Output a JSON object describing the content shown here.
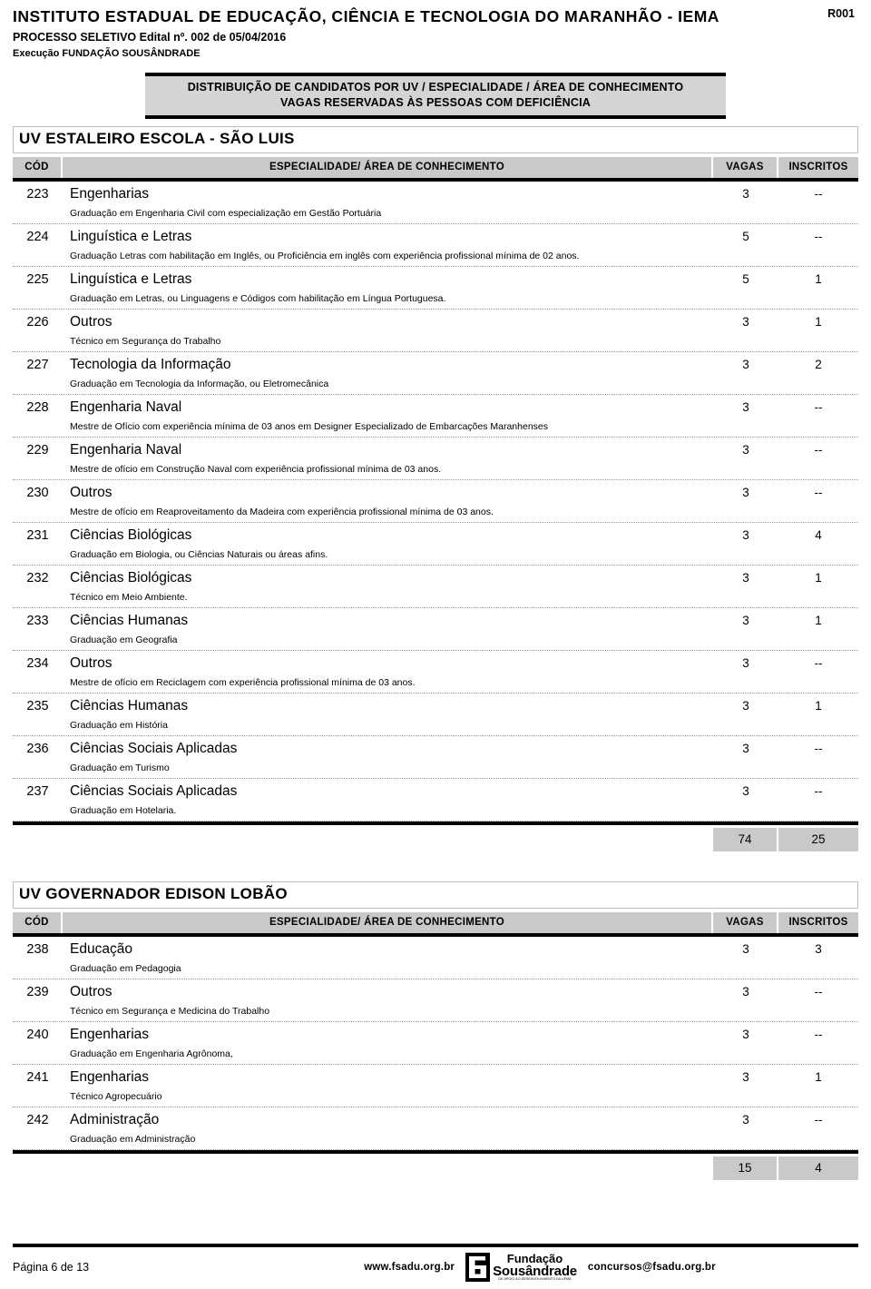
{
  "header": {
    "institution": "INSTITUTO ESTADUAL DE EDUCAÇÃO, CIÊNCIA E TECNOLOGIA DO MARANHÃO - IEMA",
    "doc_code": "R001",
    "process_line": "PROCESSO SELETIVO Edital nº. 002 de 05/04/2016",
    "execution_line": "Execução FUNDAÇÃO SOUSÂNDRADE"
  },
  "banner": {
    "line1": "DISTRIBUIÇÃO DE CANDIDATOS POR UV / ESPECIALIDADE / ÁREA DE CONHECIMENTO",
    "line2": "VAGAS RESERVADAS ÀS PESSOAS COM DEFICIÊNCIA"
  },
  "columns": {
    "cod": "CÓD",
    "especialidade": "ESPECIALIDADE/ ÁREA DE CONHECIMENTO",
    "vagas": "VAGAS",
    "inscritos": "INSCRITOS"
  },
  "sections": [
    {
      "title": "UV ESTALEIRO ESCOLA - SÃO LUIS",
      "rows": [
        {
          "cod": "223",
          "especialidade": "Engenharias",
          "descricao": "Graduação em Engenharia Civil com especialização em Gestão Portuária",
          "vagas": "3",
          "inscritos": "--"
        },
        {
          "cod": "224",
          "especialidade": "Linguística e Letras",
          "descricao": "Graduação Letras com habilitação em Inglês, ou Proficiência em inglês com experiência profissional mínima de 02 anos.",
          "vagas": "5",
          "inscritos": "--"
        },
        {
          "cod": "225",
          "especialidade": "Linguística e Letras",
          "descricao": "Graduação em Letras, ou Linguagens e Códigos com habilitação em Língua Portuguesa.",
          "vagas": "5",
          "inscritos": "1"
        },
        {
          "cod": "226",
          "especialidade": "Outros",
          "descricao": "Técnico em Segurança do Trabalho",
          "vagas": "3",
          "inscritos": "1"
        },
        {
          "cod": "227",
          "especialidade": "Tecnologia da Informação",
          "descricao": "Graduação em Tecnologia da Informação, ou Eletromecânica",
          "vagas": "3",
          "inscritos": "2"
        },
        {
          "cod": "228",
          "especialidade": "Engenharia Naval",
          "descricao": "Mestre de Ofício com experiência mínima de 03 anos em Designer Especializado de Embarcações Maranhenses",
          "vagas": "3",
          "inscritos": "--"
        },
        {
          "cod": "229",
          "especialidade": "Engenharia Naval",
          "descricao": "Mestre de ofício em Construção Naval com experiência profissional mínima de 03 anos.",
          "vagas": "3",
          "inscritos": "--"
        },
        {
          "cod": "230",
          "especialidade": "Outros",
          "descricao": "Mestre de ofício em Reaproveitamento da Madeira com experiência profissional mínima de 03 anos.",
          "vagas": "3",
          "inscritos": "--"
        },
        {
          "cod": "231",
          "especialidade": "Ciências Biológicas",
          "descricao": "Graduação em Biologia, ou Ciências Naturais ou áreas afins.",
          "vagas": "3",
          "inscritos": "4"
        },
        {
          "cod": "232",
          "especialidade": "Ciências Biológicas",
          "descricao": "Técnico em Meio Ambiente.",
          "vagas": "3",
          "inscritos": "1"
        },
        {
          "cod": "233",
          "especialidade": "Ciências Humanas",
          "descricao": "Graduação em Geografia",
          "vagas": "3",
          "inscritos": "1"
        },
        {
          "cod": "234",
          "especialidade": "Outros",
          "descricao": "Mestre de ofício em Reciclagem com experiência profissional mínima de 03 anos.",
          "vagas": "3",
          "inscritos": "--"
        },
        {
          "cod": "235",
          "especialidade": "Ciências Humanas",
          "descricao": "Graduação em História",
          "vagas": "3",
          "inscritos": "1"
        },
        {
          "cod": "236",
          "especialidade": "Ciências Sociais Aplicadas",
          "descricao": "Graduação em Turismo",
          "vagas": "3",
          "inscritos": "--"
        },
        {
          "cod": "237",
          "especialidade": "Ciências Sociais Aplicadas",
          "descricao": "Graduação em Hotelaria.",
          "vagas": "3",
          "inscritos": "--"
        }
      ],
      "total_vagas": "74",
      "total_inscritos": "25"
    },
    {
      "title": "UV GOVERNADOR EDISON LOBÃO",
      "rows": [
        {
          "cod": "238",
          "especialidade": "Educação",
          "descricao": "Graduação em Pedagogia",
          "vagas": "3",
          "inscritos": "3"
        },
        {
          "cod": "239",
          "especialidade": "Outros",
          "descricao": "Técnico em Segurança e Medicina do Trabalho",
          "vagas": "3",
          "inscritos": "--"
        },
        {
          "cod": "240",
          "especialidade": "Engenharias",
          "descricao": "Graduação em Engenharia Agrônoma,",
          "vagas": "3",
          "inscritos": "--"
        },
        {
          "cod": "241",
          "especialidade": "Engenharias",
          "descricao": "Técnico Agropecuário",
          "vagas": "3",
          "inscritos": "1"
        },
        {
          "cod": "242",
          "especialidade": "Administração",
          "descricao": "Graduação em Administração",
          "vagas": "3",
          "inscritos": "--"
        }
      ],
      "total_vagas": "15",
      "total_inscritos": "4"
    }
  ],
  "footer": {
    "page_label": "Página 6 de  13",
    "website": "www.fsadu.org.br",
    "email": "concursos@fsadu.org.br",
    "logo_line1": "Fundação",
    "logo_line2": "Sousândrade",
    "logo_line3": "DE APOIO AO DESENVOLVIMENTO DA UFMA"
  },
  "colors": {
    "banner_bg": "#d4d4d4",
    "header_bg": "#c9c9c9",
    "rule": "#000000"
  }
}
